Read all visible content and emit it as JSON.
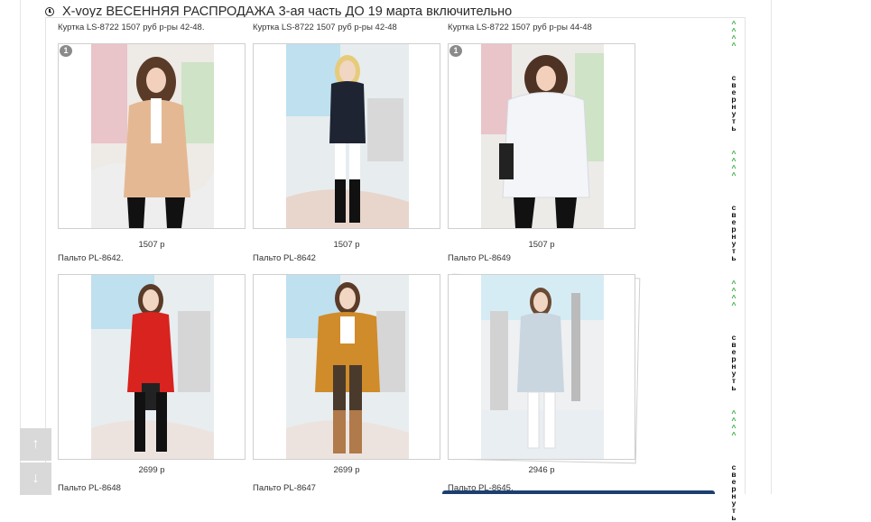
{
  "header": {
    "title": "X-voyz ВЕСЕННЯЯ РАСПРОДАЖА 3-ая часть ДО  19 марта включительно"
  },
  "products": [
    {
      "caption": "Куртка LS-8722 1507 руб р-ры 42-48.",
      "price": "1507 р",
      "badge": "1"
    },
    {
      "caption": "Куртка LS-8722 1507 руб р-ры 42-48",
      "price": "1507 р"
    },
    {
      "caption": "Куртка LS-8722 1507 руб р-ры 44-48",
      "price": "1507 р",
      "badge": "1"
    },
    {
      "caption": "Пальто PL-8642.",
      "price": "2699 р"
    },
    {
      "caption": "Пальто PL-8642",
      "price": "2699 р"
    },
    {
      "caption": "Пальто PL-8649",
      "price": "2946 р"
    },
    {
      "caption": "Пальто PL-8648"
    },
    {
      "caption": "Пальто PL-8647"
    },
    {
      "caption": "Пальто PL-8645."
    }
  ],
  "sidebar": {
    "arrows": "^^^^",
    "collapse": "свернуть"
  },
  "scroll": {
    "up": "↑",
    "down": "↓"
  },
  "colors": {
    "arrow_green": "#35a83c",
    "coat_beige": "#e5b894",
    "coat_navy": "#1f2433",
    "coat_white": "#f4f5f8",
    "coat_red": "#d8231f",
    "coat_mustard": "#d08b2a",
    "coat_grey": "#c9d6df"
  }
}
